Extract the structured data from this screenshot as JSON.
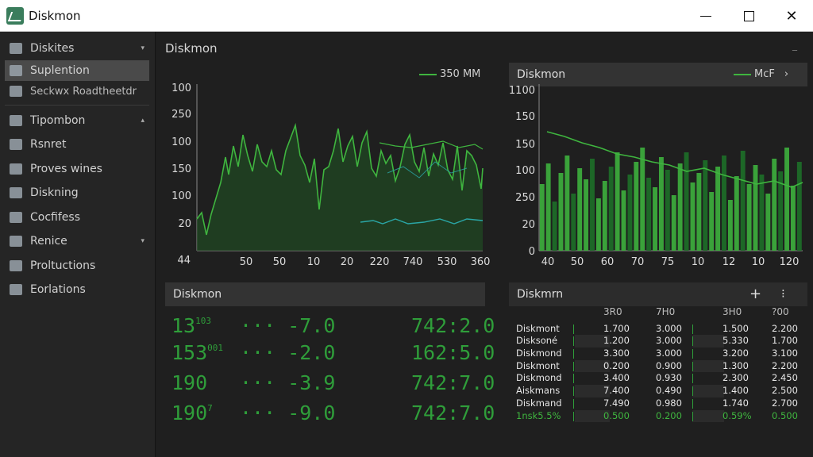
{
  "window": {
    "title": "Diskmon"
  },
  "sidebar": {
    "items": [
      {
        "label": "Diskites",
        "icon": "disk-icon",
        "chevron": "▾"
      },
      {
        "label": "Suplention",
        "icon": "split-icon",
        "chevron": ""
      },
      {
        "label": "Seckwx Roadtheetdr",
        "icon": "monitor-icon",
        "chevron": ""
      },
      {
        "label": "Tipombon",
        "icon": "drive-icon",
        "chevron": "▴"
      },
      {
        "label": "Rsnret",
        "icon": "grid-icon",
        "chevron": ""
      },
      {
        "label": "Proves wines",
        "icon": "tree-icon",
        "chevron": ""
      },
      {
        "label": "Diskning",
        "icon": "storage-icon",
        "chevron": ""
      },
      {
        "label": "Cocfifess",
        "icon": "folder-icon",
        "chevron": ""
      },
      {
        "label": "Renice",
        "icon": "wrench-icon",
        "chevron": "▾"
      },
      {
        "label": "Proltuctions",
        "icon": "gear-icon",
        "chevron": ""
      },
      {
        "label": "Eorlations",
        "icon": "monitor-icon",
        "chevron": ""
      }
    ]
  },
  "main": {
    "title": "Diskmon",
    "corner": "_"
  },
  "chart_left": {
    "legend": "350 MM",
    "y_ticks": [
      "100",
      "250",
      "100",
      "150",
      "100",
      "20",
      "44"
    ],
    "x_ticks": [
      "50",
      "50",
      "10",
      "20",
      "220",
      "740",
      "530",
      "360"
    ],
    "colors": {
      "line": "#3fb53f",
      "area": "#1f4a22",
      "cyan": "#2aa6a6"
    }
  },
  "chart_right": {
    "header": "Diskmon",
    "legend": "McF",
    "legend_chevron": "›",
    "y_ticks": [
      "1100",
      "150",
      "150",
      "100",
      "250",
      "20",
      "0"
    ],
    "x_ticks": [
      "40",
      "50",
      "60",
      "70",
      "75",
      "10",
      "12",
      "10",
      "120"
    ],
    "colors": {
      "bar": "#3caa3c",
      "bar_dark": "#1e6b28",
      "line": "#3fb53f"
    }
  },
  "metrics_panel": {
    "header": "Diskmon",
    "rows": [
      {
        "left": "13",
        "sup": "103",
        "mid": "··· -7.0",
        "right": "742:2.0"
      },
      {
        "left": "153",
        "sup": "001",
        "mid": "··· -2.0",
        "right": "162:5.0"
      },
      {
        "left": "190",
        "sup": "",
        "mid": "··· -3.9",
        "right": "742:7.0"
      },
      {
        "left": "190",
        "sup": "7",
        "mid": "··· -9.0",
        "right": "742:7.0"
      }
    ]
  },
  "table_panel": {
    "header": "Diskmrn",
    "add_label": "+",
    "more_label": "⁝",
    "columns": [
      "",
      "3R0",
      "7H0",
      "3H0",
      "?00"
    ],
    "rows": [
      [
        "Diskmont",
        "1.700",
        "3.000",
        "1.500",
        "2.200"
      ],
      [
        "Disksoné",
        "1.200",
        "3.000",
        "5.330",
        "1.700"
      ],
      [
        "Diskmond",
        "3.300",
        "3.000",
        "3.200",
        "3.100"
      ],
      [
        "Diskmont",
        "0.200",
        "0.900",
        "1.300",
        "2.200"
      ],
      [
        "Diskmond",
        "3.400",
        "0.930",
        "2.300",
        "2.450"
      ],
      [
        "Aiskmans",
        "7.400",
        "0.490",
        "1.400",
        "2.500"
      ],
      [
        "Diskmand",
        "7.490",
        "0.980",
        "1.740",
        "2.700"
      ],
      [
        "1nsk5.5%",
        "0.500",
        "0.200",
        "0.59%",
        "0.500"
      ]
    ]
  }
}
